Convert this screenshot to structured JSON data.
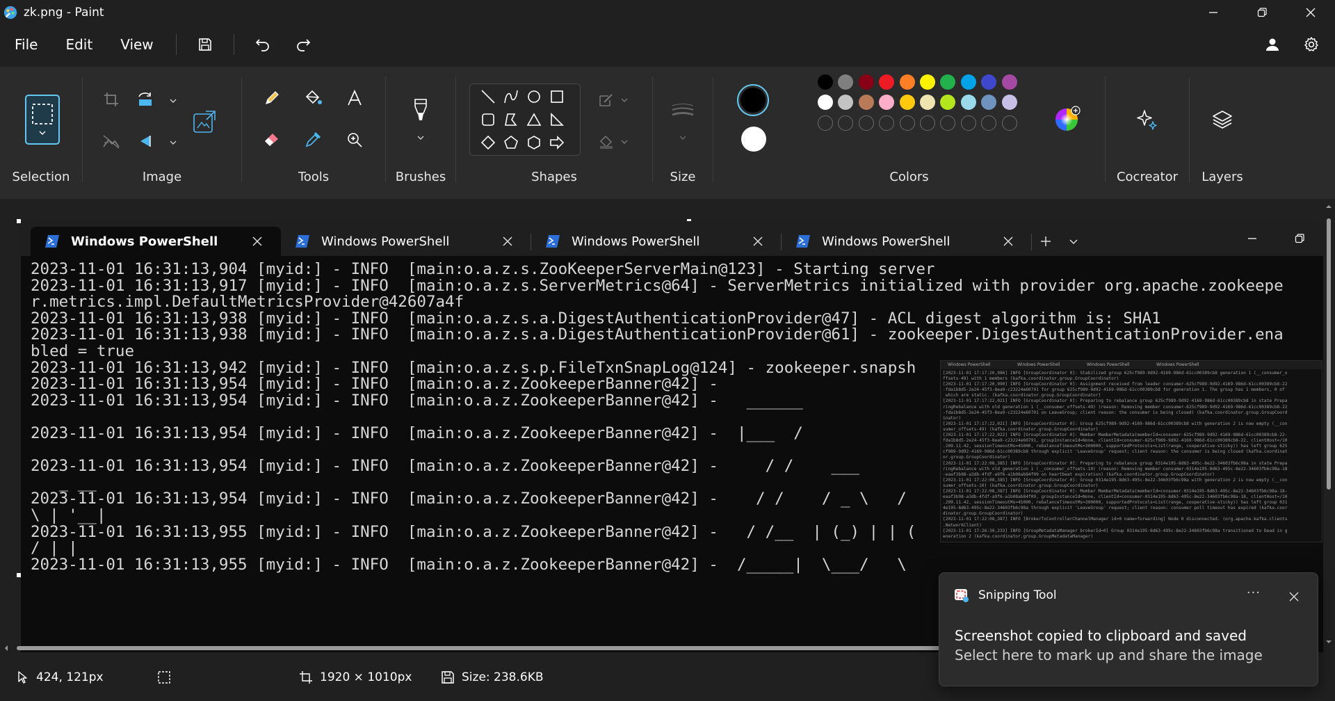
{
  "window": {
    "title": "zk.png - Paint"
  },
  "menu": {
    "file": "File",
    "edit": "Edit",
    "view": "View"
  },
  "ribbon": {
    "groups": {
      "selection": "Selection",
      "image": "Image",
      "tools": "Tools",
      "brushes": "Brushes",
      "shapes": "Shapes",
      "size": "Size",
      "colors": "Colors",
      "cocreator": "Cocreator",
      "layers": "Layers"
    },
    "primary_color": "#000000",
    "secondary_color": "#ffffff",
    "palette_row1": [
      "#000000",
      "#7f7f7f",
      "#880015",
      "#ed1c24",
      "#ff7f27",
      "#fff200",
      "#22b14c",
      "#00a2e8",
      "#3f48cc",
      "#a349a4"
    ],
    "palette_row2": [
      "#ffffff",
      "#c3c3c3",
      "#b97a57",
      "#ffaec9",
      "#ffc90e",
      "#efe4b0",
      "#b5e61d",
      "#99d9ea",
      "#7092be",
      "#c8bfe7"
    ]
  },
  "powershell": {
    "tabs": [
      "Windows PowerShell",
      "Windows PowerShell",
      "Windows PowerShell",
      "Windows PowerShell"
    ],
    "lines": [
      "2023-11-01 16:31:13,904 [myid:] - INFO  [main:o.a.z.s.ZooKeeperServerMain@123] - Starting server",
      "2023-11-01 16:31:13,917 [myid:] - INFO  [main:o.a.z.s.ServerMetrics@64] - ServerMetrics initialized with provider org.apache.zookeepe",
      "r.metrics.impl.DefaultMetricsProvider@42607a4f",
      "2023-11-01 16:31:13,938 [myid:] - INFO  [main:o.a.z.s.a.DigestAuthenticationProvider@47] - ACL digest algorithm is: SHA1",
      "2023-11-01 16:31:13,938 [myid:] - INFO  [main:o.a.z.s.a.DigestAuthenticationProvider@61] - zookeeper.DigestAuthenticationProvider.ena",
      "bled = true",
      "2023-11-01 16:31:13,942 [myid:] - INFO  [main:o.a.z.s.p.FileTxnSnapLog@124] - zookeeper.snapsh",
      "2023-11-01 16:31:13,954 [myid:] - INFO  [main:o.a.z.ZookeeperBanner@42] -",
      "2023-11-01 16:31:13,954 [myid:] - INFO  [main:o.a.z.ZookeeperBanner@42] -   ______",
      "",
      "2023-11-01 16:31:13,954 [myid:] - INFO  [main:o.a.z.ZookeeperBanner@42] -  |___  /",
      "",
      "2023-11-01 16:31:13,954 [myid:] - INFO  [main:o.a.z.ZookeeperBanner@42] -     / /    ___",
      "   _ __",
      "2023-11-01 16:31:13,954 [myid:] - INFO  [main:o.a.z.ZookeeperBanner@42] -    / /    / _ \\   /",
      "\\ | '__|",
      "2023-11-01 16:31:13,955 [myid:] - INFO  [main:o.a.z.ZookeeperBanner@42] -   / /__  | (_) | | (",
      "/ | |",
      "2023-11-01 16:31:13,955 [myid:] - INFO  [main:o.a.z.ZookeeperBanner@42] -  /_____|  \\___/   \\"
    ],
    "thumbnail": {
      "tabs": [
        "Windows PowerShell",
        "Windows PowerShell",
        "Windows PowerShell",
        "Windows PowerShell"
      ],
      "lines": [
        "[2023-11-01 17:17:20,986] INFO [GroupCoordinator 0]: Stabilized group 625cf989-9d92-4169-986d-61cc00389cb8 generation 1 (__consumer_o",
        "ffsets-49) with 1 members (kafka.coordinator.group.GroupCoordinator)",
        "[2023-11-01 17:17:20,990] INFO [GroupCoordinator 0]: Assignment received from leader consumer-625cf989-9d92-4169-986d-61cc00389cb8-22",
        "-fda1b8d5-2e24-45f3-8ea9-c23224e60791 for group 625cf989-9d92-4169-986d-61cc00389cb8 for generation 1. The group has 1 members, 0 of",
        " which are static. (kafka.coordinator.group.GroupCoordinator)",
        "[2023-11-01 17:17:22,021] INFO [GroupCoordinator 0]: Preparing to rebalance group 625cf989-9d92-4169-986d-61cc00389cb8 in state Prepa",
        "ringRebalance with old generation 1 (__consumer_offsets-49) (reason: Removing member consumer-625cf989-9d92-4169-986d-61cc00389cb8-22",
        "-fda1b8d5-2e24-45f3-8ea9-c23224e60791 on LeaveGroup; client reason: the consumer is being closed) (kafka.coordinator.group.GroupCoord",
        "inator)",
        "[2023-11-01 17:17:22,021] INFO [GroupCoordinator 0]: Group 625cf989-9d92-4169-986d-61cc00389cb8 with generation 2 is now empty (__con",
        "sumer_offsets-49) (kafka.coordinator.group.GroupCoordinator)",
        "[2023-11-01 17:17:22,022] INFO [GroupCoordinator 0]: Member MemberMetadata(memberId=consumer-625cf989-9d92-4169-986d-61cc00389cb8-22-",
        "fda1b8d5-2e24-45f3-8ea9-c23224e60791, groupInstanceId=None, clientId=consumer-625cf989-9d92-4169-986d-61cc00389cb8-22, clientHost=/10",
        ".209.11.42, sessionTimeoutMs=45000, rebalanceTimeoutMs=300000, supportedProtocols=List(range, cooperative-sticky)) has left group 625",
        "cf989-9d92-4169-986d-61cc00389cb8 through explicit 'LeaveGroup' request; client reason: the consumer is being closed (kafka.coordinat",
        "or.group.GroupCoordinator)",
        "[2023-11-01 17:22:08,385] INFO [GroupCoordinator 0]: Preparing to rebalance group 0314e195-8d63-495c-8e22-34603fb6c98a in state Prepa",
        "ringRebalance with old generation 1 (__consumer_offsets-10) (reason: Removing member consumer-0314e195-8d63-495c-8e22-34603fb6c98a-18",
        "-eaaf3b98-a3db-4fdf-a9f6-a1b08ab84f09 on heartbeat expiration) (kafka.coordinator.group.GroupCoordinator)",
        "[2023-11-01 17:22:08,385] INFO [GroupCoordinator 0]: Group 0314e195-8d63-495c-8e22-34603fb6c98a with generation 2 is now empty (__con",
        "sumer_offsets-10) (kafka.coordinator.group.GroupCoordinator)",
        "[2023-11-01 17:22:08,387] INFO [GroupCoordinator 0]: Member MemberMetadata(memberId=consumer-0314e195-8d63-495c-8e22-34603fb6c98a-18-",
        "eaaf3b98-a3db-4fdf-a9f6-a1b08ab84f09, groupInstanceId=None, clientId=consumer-0314e195-8d63-495c-8e22-34603fb6c98a-18, clientHost=/10",
        ".209.11.42, sessionTimeoutMs=45000, rebalanceTimeoutMs=300000, supportedProtocols=List(range, cooperative-sticky)) has left group 031",
        "4e195-8d63-495c-8e22-34603fb6c98a through explicit 'LeaveGroup' request; client reason: consumer poll timeout has expired (kafka.coor",
        "dinator.group.GroupCoordinator)",
        "[2023-11-01 17:22:08,387] INFO [BrokerToControllerChannelManager id=0 name=forwarding] Node 0 disconnected. (org.apache.kafka.clients",
        ".NetworkClient)",
        "[2023-11-01 17:26:30,233] INFO [GroupMetadataManager brokerId=0] Group 0314e195-8d63-495c-8e22-34603fb6c98a transitioned to Dead in g",
        "eneration 2 (kafka.coordinator.group.GroupMetadataManager)"
      ]
    }
  },
  "status": {
    "cursor_position": "424, 121px",
    "canvas_size": "1920 × 1010px",
    "file_size": "Size: 238.6KB"
  },
  "toast": {
    "app_name": "Snipping Tool",
    "more": "···",
    "title": "Screenshot copied to clipboard and saved",
    "body": "Select here to mark up and share the image"
  }
}
